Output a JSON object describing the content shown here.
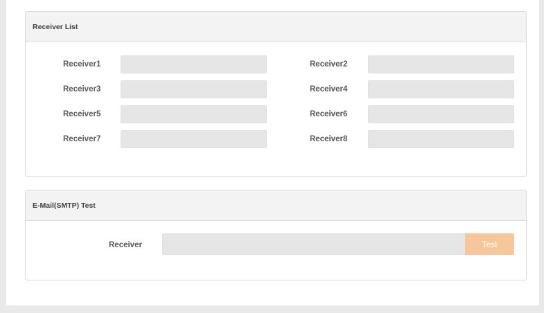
{
  "receiver_list": {
    "title": "Receiver List",
    "fields": [
      {
        "label": "Receiver1",
        "value": "",
        "placeholder": ""
      },
      {
        "label": "Receiver2",
        "value": "",
        "placeholder": ""
      },
      {
        "label": "Receiver3",
        "value": "",
        "placeholder": ""
      },
      {
        "label": "Receiver4",
        "value": "",
        "placeholder": ""
      },
      {
        "label": "Receiver5",
        "value": "",
        "placeholder": ""
      },
      {
        "label": "Receiver6",
        "value": "",
        "placeholder": ""
      },
      {
        "label": "Receiver7",
        "value": "",
        "placeholder": ""
      },
      {
        "label": "Receiver8",
        "value": "",
        "placeholder": ""
      }
    ]
  },
  "smtp_test": {
    "title": "E-Mail(SMTP) Test",
    "receiver_label": "Receiver",
    "receiver_value": "",
    "receiver_placeholder": "",
    "test_button_label": "Test",
    "test_button_color": "#f6c79b"
  },
  "colors": {
    "page_background": "#e9e9e9",
    "panel_header_background": "#f3f3f3",
    "input_background": "#e6e6e6",
    "label_text": "#595959"
  }
}
